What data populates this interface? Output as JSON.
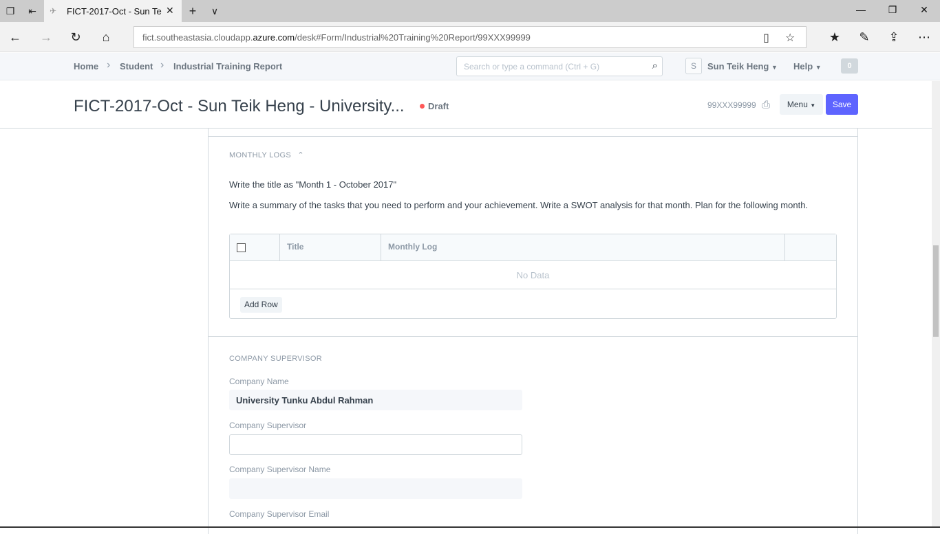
{
  "browser": {
    "tab_title": "FICT-2017-Oct - Sun Tei",
    "url_pre": "fict.southeastasia.cloudapp.",
    "url_host": "azure.com",
    "url_post": "/desk#Form/Industrial%20Training%20Report/99XXX99999"
  },
  "appbar": {
    "breadcrumbs": [
      "Home",
      "Student",
      "Industrial Training Report"
    ],
    "search_placeholder": "Search or type a command (Ctrl + G)",
    "avatar_letter": "S",
    "user_name": "Sun Teik Heng",
    "help_label": "Help",
    "notification_count": "0"
  },
  "page": {
    "title": "FICT-2017-Oct - Sun Teik Heng - University...",
    "status": "Draft",
    "doc_name": "99XXX99999",
    "menu_label": "Menu",
    "save_label": "Save"
  },
  "monthly_logs": {
    "heading": "MONTHLY LOGS",
    "desc1": "Write the title as \"Month 1 - October 2017\"",
    "desc2": "Write a summary of the tasks that you need to perform and your achievement. Write a SWOT analysis for that month. Plan for the following month.",
    "columns": [
      "Title",
      "Monthly Log"
    ],
    "empty_text": "No Data",
    "add_row_label": "Add Row"
  },
  "company_supervisor": {
    "heading": "COMPANY SUPERVISOR",
    "company_name_label": "Company Name",
    "company_name_value": "University Tunku Abdul Rahman",
    "supervisor_label": "Company Supervisor",
    "supervisor_value": "",
    "supervisor_name_label": "Company Supervisor Name",
    "supervisor_name_value": "",
    "supervisor_email_label": "Company Supervisor Email"
  }
}
